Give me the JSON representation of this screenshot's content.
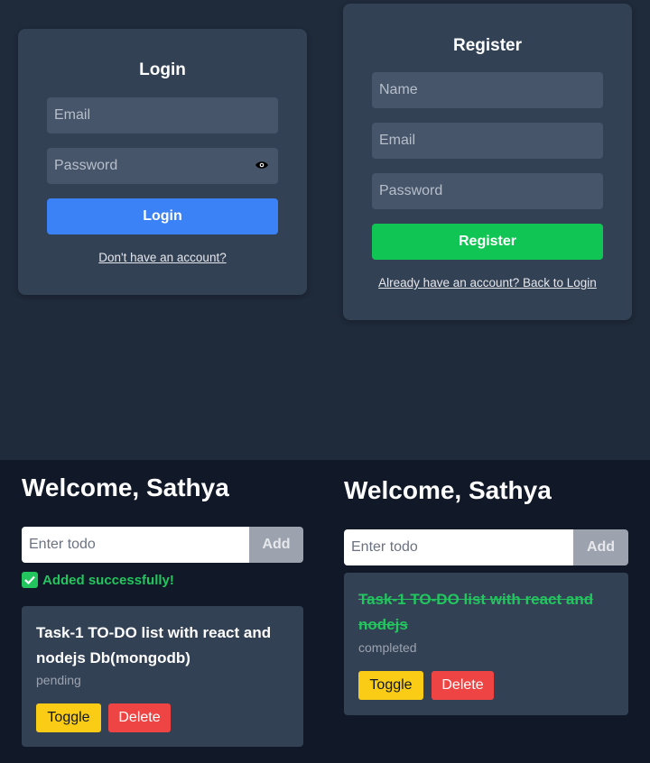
{
  "login": {
    "title": "Login",
    "email_placeholder": "Email",
    "password_placeholder": "Password",
    "submit_label": "Login",
    "link_text": "Don't have an account?"
  },
  "register": {
    "title": "Register",
    "name_placeholder": "Name",
    "email_placeholder": "Email",
    "password_placeholder": "Password",
    "submit_label": "Register",
    "link_text": "Already have an account? Back to Login"
  },
  "todo_left": {
    "welcome": "Welcome, Sathya",
    "input_placeholder": "Enter todo",
    "add_label": "Add",
    "success_message": "Added successfully!",
    "item": {
      "text": "Task-1 TO-DO list with react and nodejs Db(mongodb)",
      "status": "pending",
      "toggle_label": "Toggle",
      "delete_label": "Delete"
    }
  },
  "todo_right": {
    "welcome": "Welcome, Sathya",
    "input_placeholder": "Enter todo",
    "add_label": "Add",
    "item": {
      "text": "Task-1 TO-DO list with react and nodejs",
      "status": "completed",
      "toggle_label": "Toggle",
      "delete_label": "Delete"
    }
  },
  "icons": {
    "password_visibility": "eye-icon",
    "success": "check-icon"
  },
  "colors": {
    "primary_blue": "#3b82f6",
    "register_green": "#10c554",
    "success_green": "#22c55e",
    "toggle_yellow": "#facc15",
    "delete_red": "#ef4444"
  }
}
